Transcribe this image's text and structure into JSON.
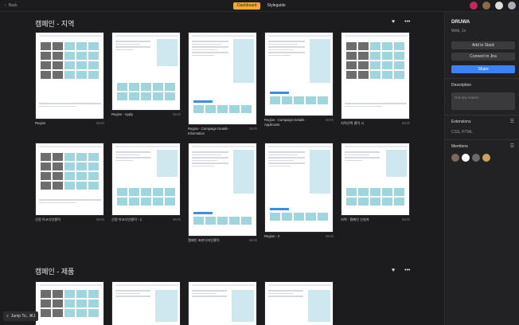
{
  "topbar": {
    "back_label": "Back",
    "tabs": [
      {
        "label": "Dashboard",
        "active": true
      },
      {
        "label": "Styleguide",
        "active": false
      }
    ]
  },
  "sections": [
    {
      "title": "캠페인 - 지역",
      "cards": [
        {
          "label": "Region",
          "meta": "Bmth"
        },
        {
          "label": "Region - Apply",
          "meta": "Bmth"
        },
        {
          "label": "Region - Campaign Details - Information",
          "meta": "Bmth"
        },
        {
          "label": "Region - Campaign Details - Applicants",
          "meta": "Bmth"
        },
        {
          "label": "지역선택 클릭 시",
          "meta": "Bmth"
        },
        {
          "label": "선정 아코디언클릭",
          "meta": "Bmth"
        },
        {
          "label": "선정 아코디언클릭 - 1",
          "meta": "Bmth"
        },
        {
          "label": "캠페인 표본디자인클릭",
          "meta": "Bmth"
        },
        {
          "label": "Region - 2",
          "meta": "Bmth"
        },
        {
          "label": "지역 - 캠페인 신청자",
          "meta": "Bmth"
        }
      ]
    },
    {
      "title": "캠페인 - 제품",
      "cards": []
    }
  ],
  "search": {
    "label": "Jump To.. ⌘J"
  },
  "sidebar": {
    "project_name": "DRUWA",
    "project_meta": "Web, 1x",
    "add_to_slack": "Add to Slack",
    "connect_jira": "Connect to Jira",
    "share": "Share",
    "description_title": "Description",
    "description_placeholder": "Got any notes?",
    "extensions_title": "Extensions",
    "extensions_value": "CSS, HTML",
    "members_title": "Members",
    "member_avatar_colors": [
      "#7a6a5a",
      "#ffffff",
      "#6a6a6a",
      "#c9a35a"
    ]
  },
  "colors": {
    "accent": "#f0a830",
    "share": "#3b82f6"
  }
}
